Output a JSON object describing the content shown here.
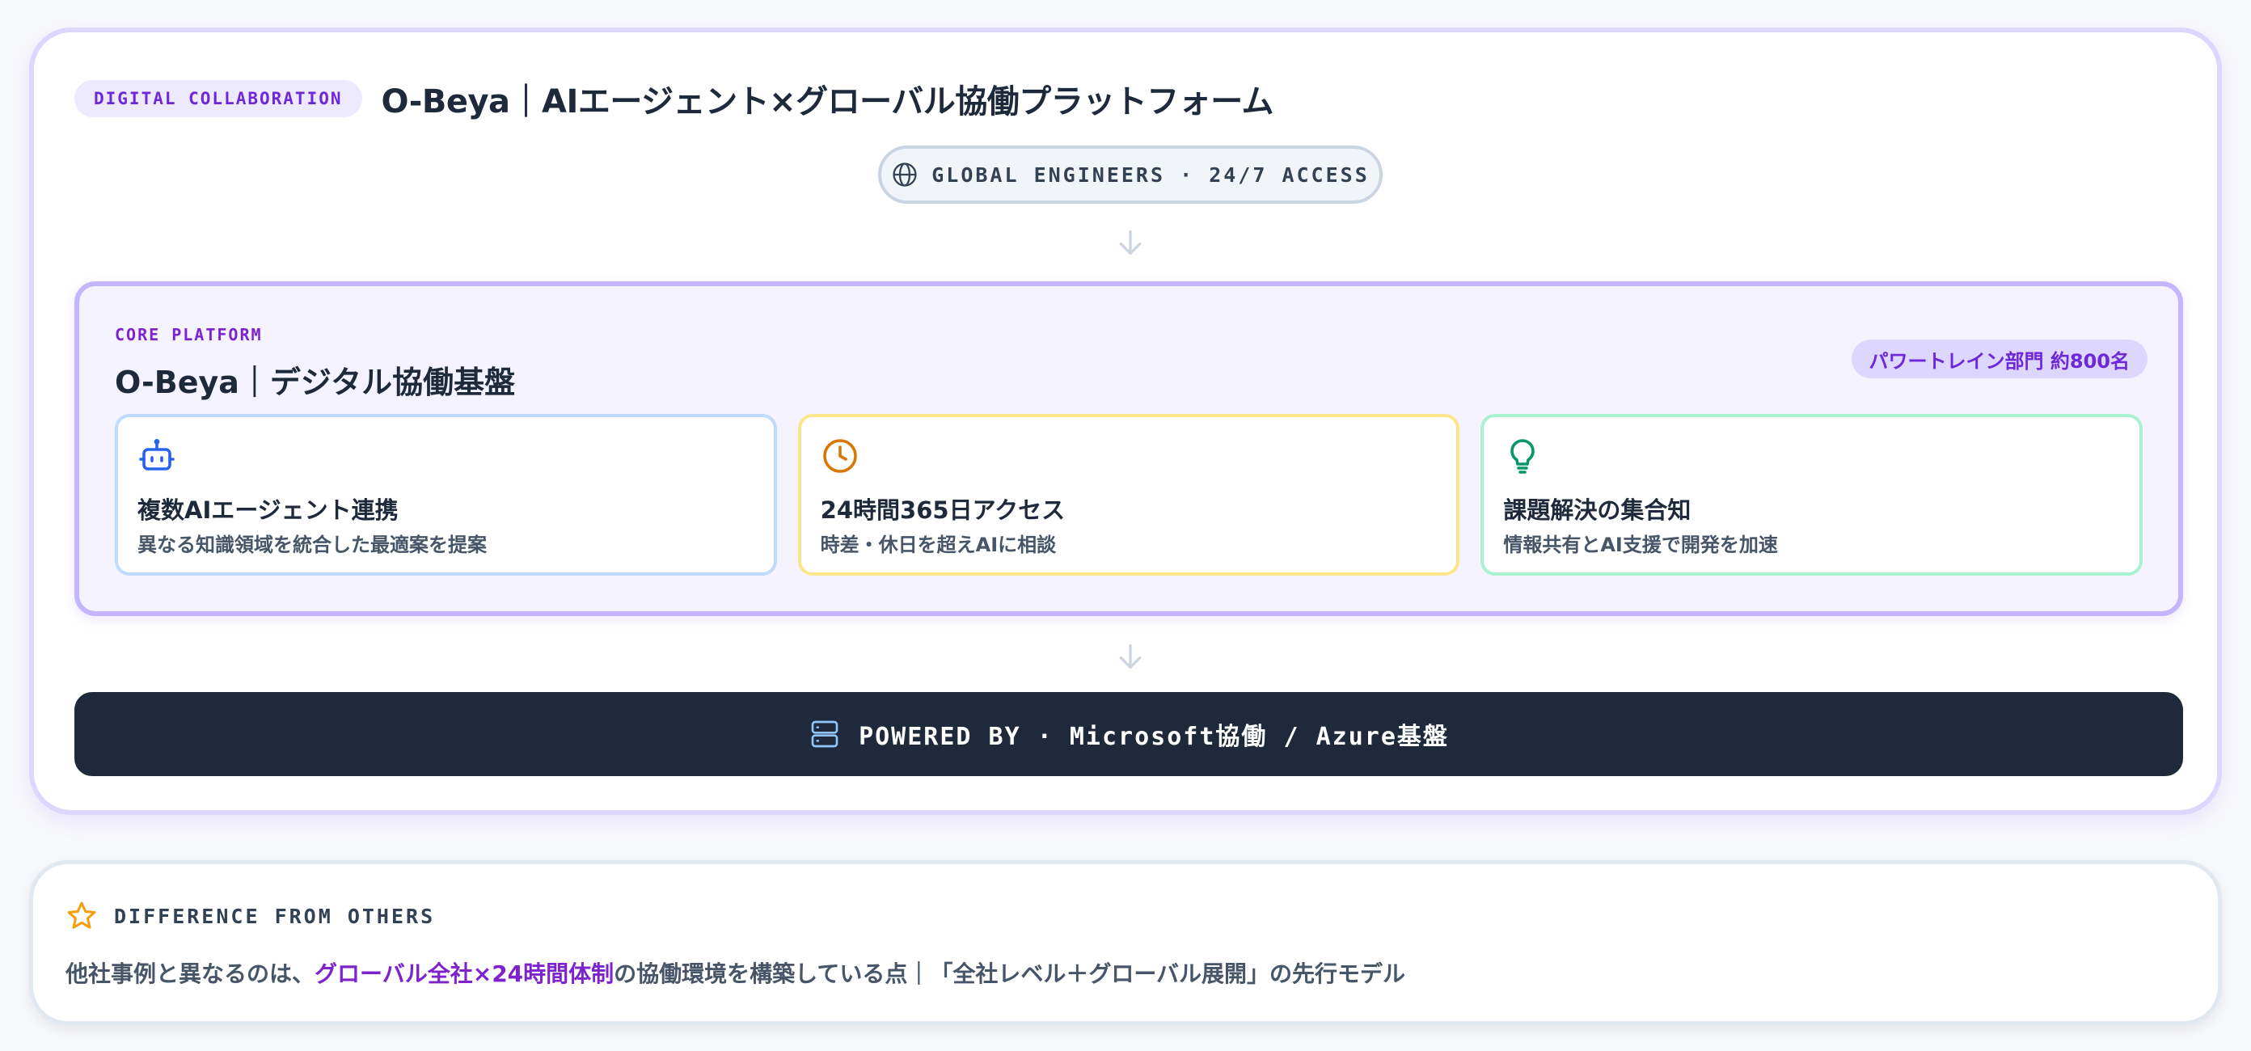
{
  "header": {
    "tag": "DIGITAL COLLABORATION",
    "title": "O-Beya｜AIエージェント×グローバル協働プラットフォーム"
  },
  "access": {
    "icon": "globe-icon",
    "label": "GLOBAL ENGINEERS · 24/7 ACCESS"
  },
  "core": {
    "kicker": "CORE PLATFORM",
    "title": "O-Beya｜デジタル協働基盤",
    "badge": "パワートレイン部門 約800名",
    "features": [
      {
        "icon": "robot-icon",
        "title": "複数AIエージェント連携",
        "desc": "異なる知識領域を統合した最適案を提案",
        "color": "#2563eb"
      },
      {
        "icon": "clock-icon",
        "title": "24時間365日アクセス",
        "desc": "時差・休日を超えAIに相談",
        "color": "#d97706"
      },
      {
        "icon": "lightbulb-icon",
        "title": "課題解決の集合知",
        "desc": "情報共有とAI支援で開発を加速",
        "color": "#059669"
      }
    ]
  },
  "powered": {
    "icon": "server-icon",
    "label": "POWERED BY · Microsoft協働 / Azure基盤"
  },
  "difference": {
    "icon": "star-icon",
    "label": "DIFFERENCE FROM OTHERS",
    "text_before": "他社事例と異なるのは、",
    "text_highlight": "グローバル全社×24時間体制",
    "text_after": "の協働環境を構築している点｜「全社レベル＋グローバル展開」の先行モデル"
  },
  "colors": {
    "accent": "#7e22ce",
    "dark_bar": "#1e293b",
    "core_border": "#c4b5fd"
  }
}
